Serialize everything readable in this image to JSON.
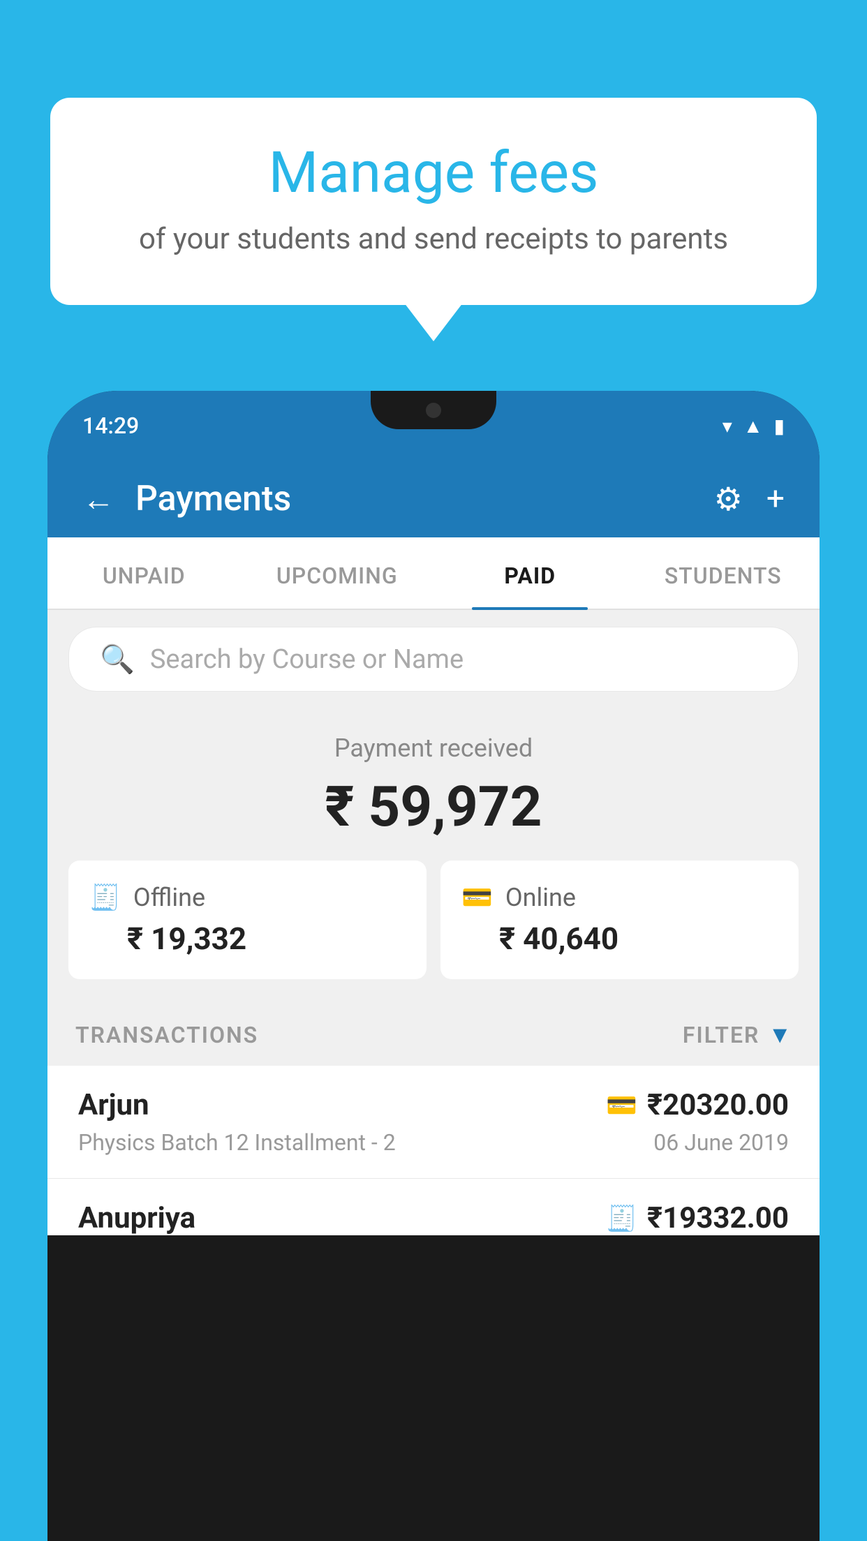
{
  "bubble": {
    "title": "Manage fees",
    "subtitle": "of your students and send receipts to parents"
  },
  "status_bar": {
    "time": "14:29"
  },
  "header": {
    "title": "Payments",
    "back_label": "←",
    "settings_icon": "⚙",
    "plus_icon": "+"
  },
  "tabs": [
    {
      "label": "UNPAID",
      "active": false
    },
    {
      "label": "UPCOMING",
      "active": false
    },
    {
      "label": "PAID",
      "active": true
    },
    {
      "label": "STUDENTS",
      "active": false
    }
  ],
  "search": {
    "placeholder": "Search by Course or Name"
  },
  "payment_summary": {
    "label": "Payment received",
    "total": "₹ 59,972",
    "offline": {
      "icon": "🧾",
      "label": "Offline",
      "amount": "₹ 19,332"
    },
    "online": {
      "icon": "💳",
      "label": "Online",
      "amount": "₹ 40,640"
    }
  },
  "transactions_header": {
    "label": "TRANSACTIONS",
    "filter_label": "FILTER"
  },
  "transactions": [
    {
      "name": "Arjun",
      "type_icon": "💳",
      "amount": "₹20320.00",
      "description": "Physics Batch 12 Installment - 2",
      "date": "06 June 2019"
    },
    {
      "name": "Anupriya",
      "type_icon": "🧾",
      "amount": "₹19332.00",
      "description": "",
      "date": ""
    }
  ],
  "colors": {
    "brand_blue": "#1e7ab8",
    "background_blue": "#29b6e8",
    "text_dark": "#222222",
    "text_gray": "#999999",
    "tab_active_underline": "#1e7ab8"
  }
}
